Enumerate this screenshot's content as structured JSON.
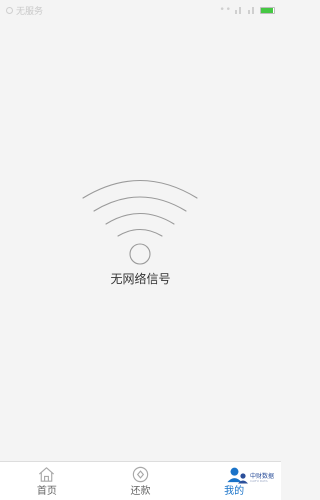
{
  "status_bar": {
    "carrier": "无服务",
    "time": "",
    "battery_color": "#45c743"
  },
  "empty_state": {
    "icon": "wifi-icon",
    "message": "无网络信号"
  },
  "tabs": [
    {
      "label": "首页",
      "icon": "home-icon",
      "active": false
    },
    {
      "label": "还款",
      "icon": "repay-icon",
      "active": false
    },
    {
      "label": "我的",
      "icon": "user-icon",
      "active": true
    }
  ],
  "watermark": {
    "title": "中财数据",
    "subtitle": "CAIFU DATA"
  },
  "colors": {
    "background": "#f4f4f4",
    "accent": "#1a73c8",
    "icon_gray": "#b5b5b5"
  }
}
